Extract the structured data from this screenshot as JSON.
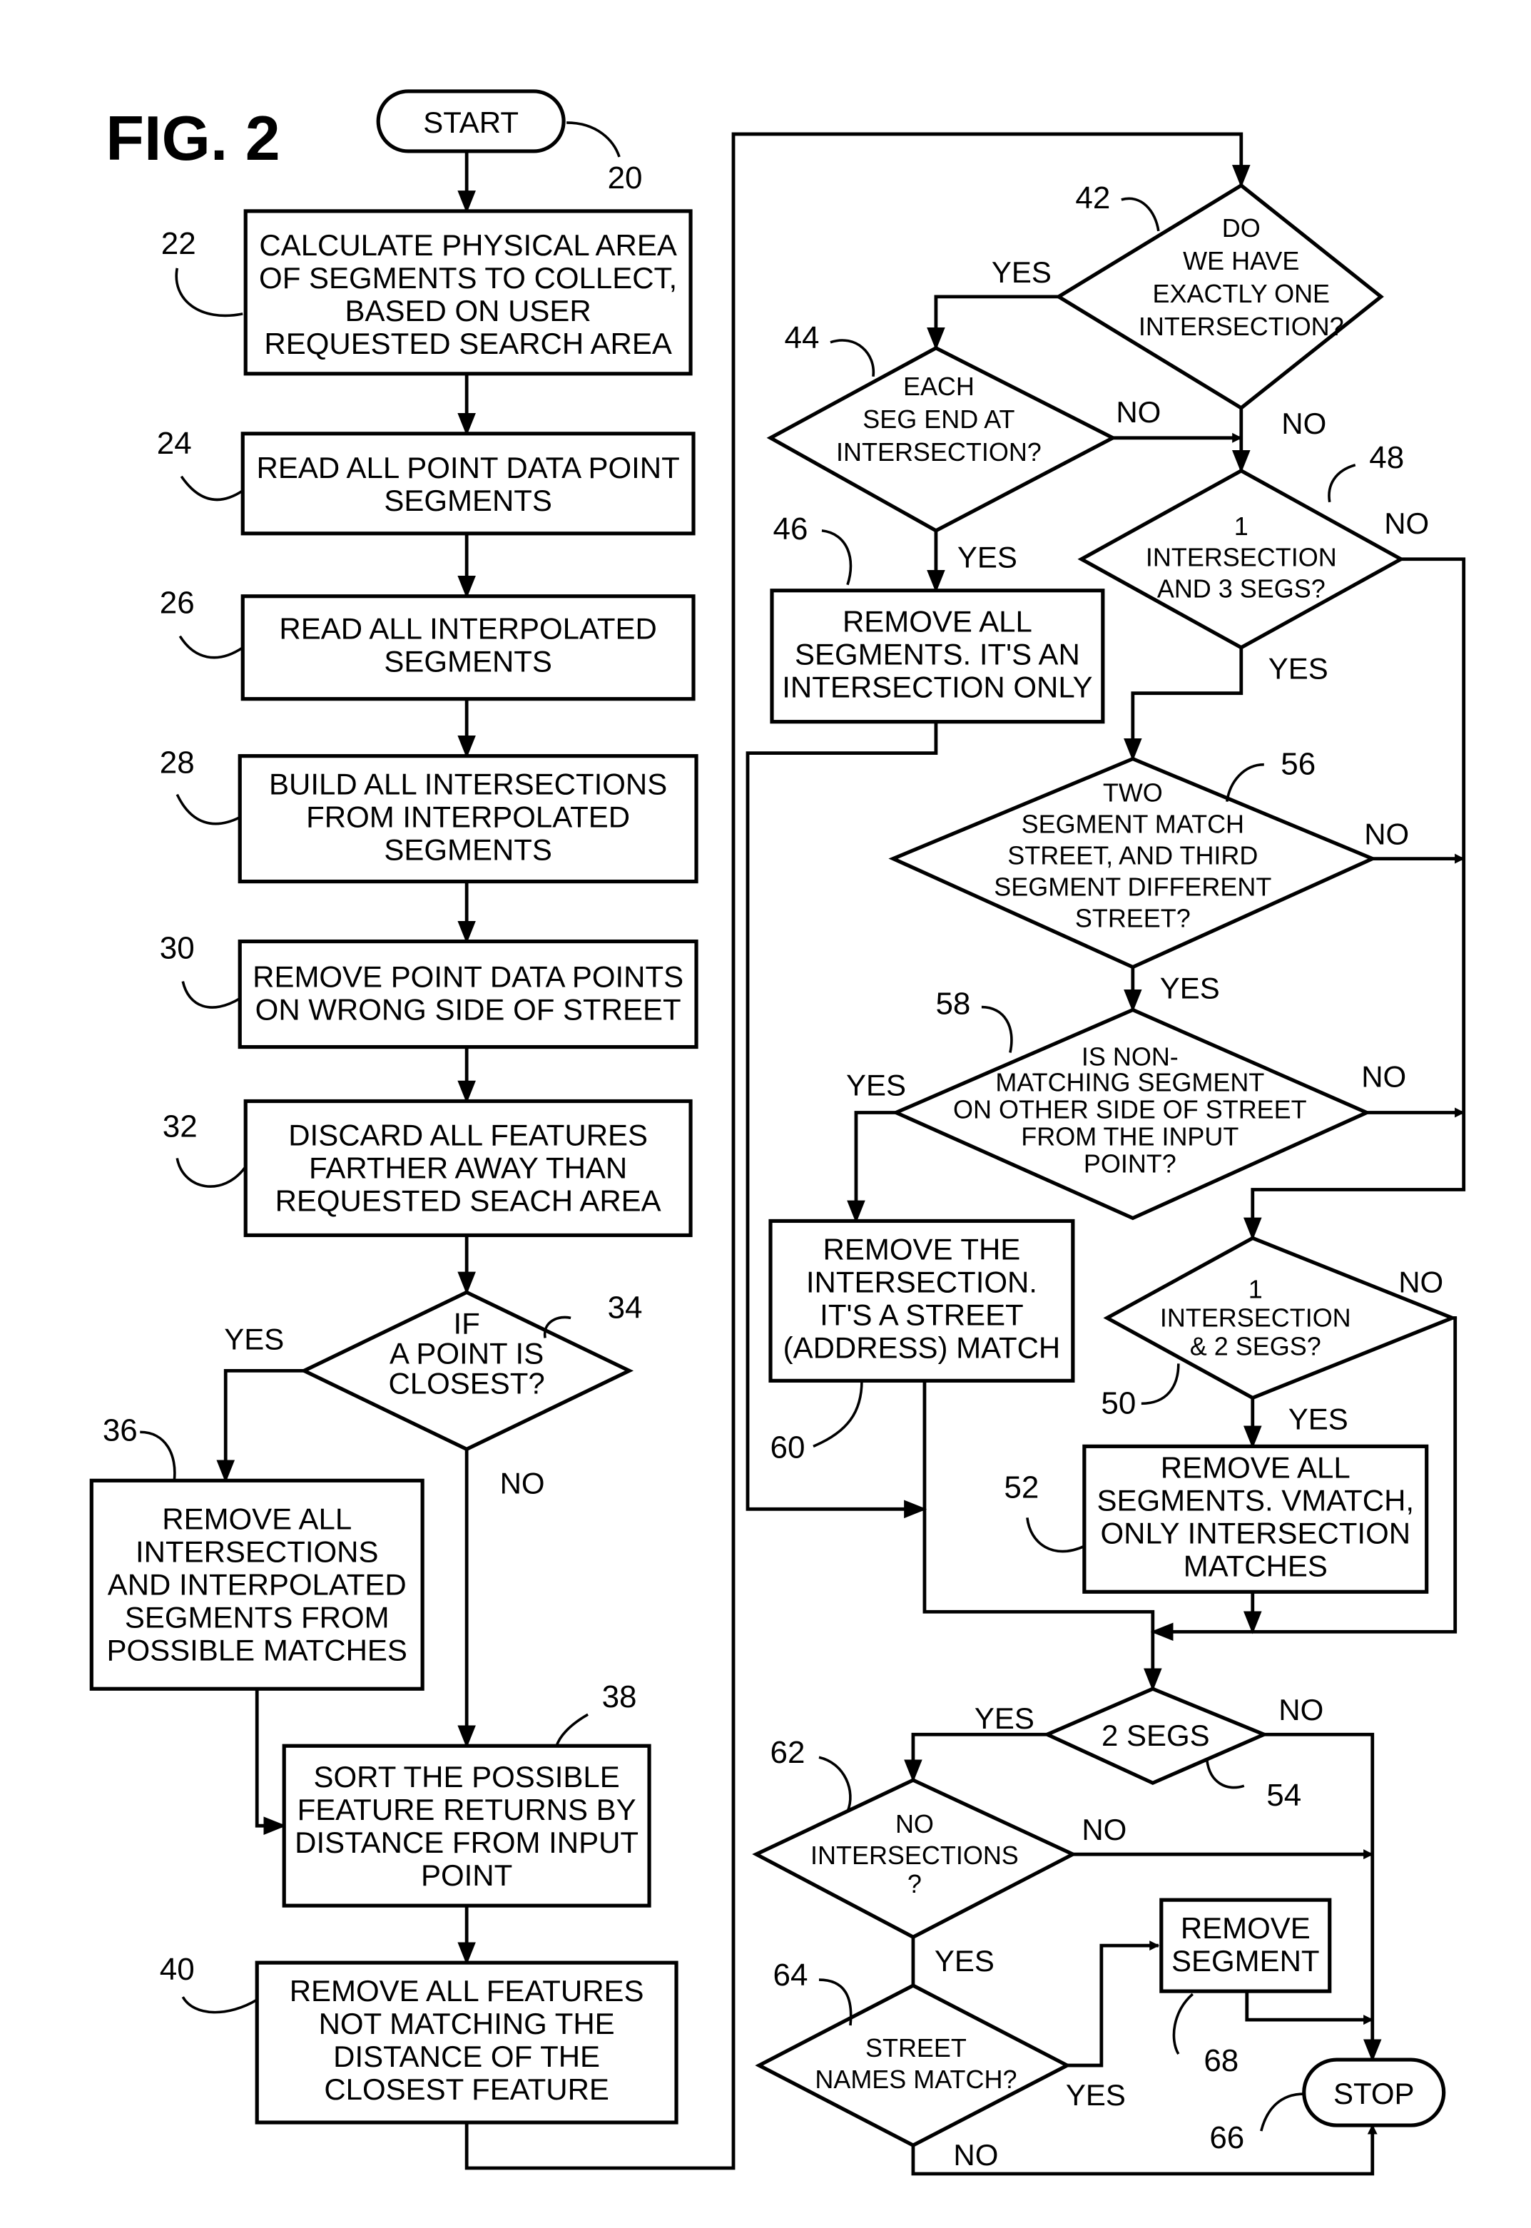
{
  "figure_title": "FIG. 2",
  "nodes": {
    "n20": {
      "ref": "20",
      "type": "terminal",
      "lines": [
        "START"
      ]
    },
    "n22": {
      "ref": "22",
      "type": "process",
      "lines": [
        "CALCULATE PHYSICAL AREA",
        "OF SEGMENTS TO COLLECT,",
        "BASED ON USER",
        "REQUESTED SEARCH AREA"
      ]
    },
    "n24": {
      "ref": "24",
      "type": "process",
      "lines": [
        "READ ALL POINT DATA POINT",
        "SEGMENTS"
      ]
    },
    "n26": {
      "ref": "26",
      "type": "process",
      "lines": [
        "READ ALL INTERPOLATED",
        "SEGMENTS"
      ]
    },
    "n28": {
      "ref": "28",
      "type": "process",
      "lines": [
        "BUILD ALL INTERSECTIONS",
        "FROM INTERPOLATED",
        "SEGMENTS"
      ]
    },
    "n30": {
      "ref": "30",
      "type": "process",
      "lines": [
        "REMOVE POINT DATA POINTS",
        "ON WRONG SIDE OF STREET"
      ]
    },
    "n32": {
      "ref": "32",
      "type": "process",
      "lines": [
        "DISCARD ALL FEATURES",
        "FARTHER AWAY THAN",
        "REQUESTED SEACH AREA"
      ]
    },
    "n34": {
      "ref": "34",
      "type": "decision",
      "lines": [
        "IF",
        "A  POINT IS",
        "CLOSEST?"
      ]
    },
    "n36": {
      "ref": "36",
      "type": "process",
      "lines": [
        "REMOVE ALL",
        "INTERSECTIONS",
        "AND INTERPOLATED",
        "SEGMENTS FROM",
        "POSSIBLE MATCHES"
      ]
    },
    "n38": {
      "ref": "38",
      "type": "process",
      "lines": [
        "SORT THE POSSIBLE",
        "FEATURE RETURNS BY",
        "DISTANCE FROM INPUT",
        "POINT"
      ]
    },
    "n40": {
      "ref": "40",
      "type": "process",
      "lines": [
        "REMOVE ALL FEATURES",
        "NOT MATCHING THE",
        "DISTANCE OF THE",
        "CLOSEST FEATURE"
      ]
    },
    "n42": {
      "ref": "42",
      "type": "decision",
      "lines": [
        "DO",
        "WE HAVE",
        "EXACTLY ONE",
        "INTERSECTION?"
      ]
    },
    "n44": {
      "ref": "44",
      "type": "decision",
      "lines": [
        "EACH",
        "SEG END AT",
        "INTERSECTION?"
      ]
    },
    "n46": {
      "ref": "46",
      "type": "process",
      "lines": [
        "REMOVE ALL",
        "SEGMENTS. IT'S AN",
        "INTERSECTION ONLY"
      ]
    },
    "n48": {
      "ref": "48",
      "type": "decision",
      "lines": [
        "1",
        "INTERSECTION",
        "AND 3 SEGS?"
      ]
    },
    "n56": {
      "ref": "56",
      "type": "decision",
      "lines": [
        "TWO",
        "SEGMENT MATCH",
        "STREET, AND THIRD",
        "SEGMENT DIFFERENT",
        "STREET?"
      ]
    },
    "n58": {
      "ref": "58",
      "type": "decision",
      "lines": [
        "IS NON-",
        "MATCHING SEGMENT",
        "ON OTHER SIDE OF STREET",
        "FROM THE INPUT",
        "POINT?"
      ]
    },
    "n60": {
      "ref": "60",
      "type": "process",
      "lines": [
        "REMOVE THE",
        "INTERSECTION.",
        "IT'S A STREET",
        "(ADDRESS) MATCH"
      ]
    },
    "n50": {
      "ref": "50",
      "type": "decision",
      "lines": [
        "1",
        "INTERSECTION",
        "& 2 SEGS?"
      ]
    },
    "n52": {
      "ref": "52",
      "type": "process",
      "lines": [
        "REMOVE ALL",
        "SEGMENTS. VMATCH,",
        "ONLY INTERSECTION",
        "MATCHES"
      ]
    },
    "n54": {
      "ref": "54",
      "type": "decision",
      "lines": [
        "2 SEGS"
      ]
    },
    "n62": {
      "ref": "62",
      "type": "decision",
      "lines": [
        "NO",
        "INTERSECTIONS",
        "?"
      ]
    },
    "n64": {
      "ref": "64",
      "type": "decision",
      "lines": [
        "STREET",
        "NAMES MATCH?"
      ]
    },
    "n68": {
      "ref": "68",
      "type": "process",
      "lines": [
        "REMOVE",
        "SEGMENT"
      ]
    },
    "n66": {
      "ref": "66",
      "type": "terminal",
      "lines": [
        "STOP"
      ]
    }
  },
  "branch_labels": {
    "yes": "YES",
    "no": "NO"
  },
  "edges": [
    {
      "from": "20",
      "to": "22"
    },
    {
      "from": "22",
      "to": "24"
    },
    {
      "from": "24",
      "to": "26"
    },
    {
      "from": "26",
      "to": "28"
    },
    {
      "from": "28",
      "to": "30"
    },
    {
      "from": "30",
      "to": "32"
    },
    {
      "from": "32",
      "to": "34"
    },
    {
      "from": "34",
      "to": "36",
      "label": "YES"
    },
    {
      "from": "34",
      "to": "38",
      "label": "NO"
    },
    {
      "from": "36",
      "to": "38"
    },
    {
      "from": "38",
      "to": "40"
    },
    {
      "from": "40",
      "to": "42"
    },
    {
      "from": "42",
      "to": "44",
      "label": "YES"
    },
    {
      "from": "42",
      "to": "48",
      "label": "NO"
    },
    {
      "from": "44",
      "to": "46",
      "label": "YES"
    },
    {
      "from": "44",
      "to": "48",
      "label": "NO"
    },
    {
      "from": "48",
      "to": "56",
      "label": "YES"
    },
    {
      "from": "48",
      "to": "50",
      "label": "NO"
    },
    {
      "from": "56",
      "to": "58",
      "label": "YES"
    },
    {
      "from": "56",
      "to": "50",
      "label": "NO"
    },
    {
      "from": "58",
      "to": "60",
      "label": "YES"
    },
    {
      "from": "58",
      "to": "50",
      "label": "NO"
    },
    {
      "from": "50",
      "to": "52",
      "label": "YES"
    },
    {
      "from": "50",
      "to": "54",
      "label": "NO"
    },
    {
      "from": "46",
      "to": "54"
    },
    {
      "from": "60",
      "to": "54"
    },
    {
      "from": "52",
      "to": "54"
    },
    {
      "from": "54",
      "to": "62",
      "label": "YES"
    },
    {
      "from": "54",
      "to": "66",
      "label": "NO"
    },
    {
      "from": "62",
      "to": "66",
      "label": "NO"
    },
    {
      "from": "62",
      "to": "64",
      "label": "YES"
    },
    {
      "from": "64",
      "to": "68",
      "label": "YES"
    },
    {
      "from": "64",
      "to": "66",
      "label": "NO"
    },
    {
      "from": "68",
      "to": "66"
    }
  ]
}
